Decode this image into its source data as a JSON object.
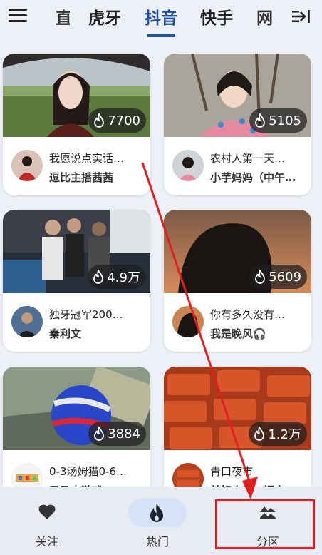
{
  "header": {
    "tabs": [
      {
        "label": "直",
        "state": "partial"
      },
      {
        "label": "虎牙",
        "state": "normal"
      },
      {
        "label": "抖音",
        "state": "active"
      },
      {
        "label": "快手",
        "state": "normal"
      },
      {
        "label": "网",
        "state": "partial"
      }
    ],
    "left_icon": "menu-icon",
    "right_icon": "collapse-sidebar-icon"
  },
  "cards": [
    {
      "title": "我愿说点实话…",
      "author": "逗比主播茜茜",
      "heat": "7700"
    },
    {
      "title": "农村人第一天…",
      "author": "小芋妈妈（中午…",
      "heat": "5105"
    },
    {
      "title": "独牙冠军200…",
      "author": "秦利文",
      "heat": "4.9万"
    },
    {
      "title": "你有多久没有…",
      "author": "我是晚风🎧",
      "heat": "5609"
    },
    {
      "title": "0-3汤姆猫0-6…",
      "author": "马马去游戏",
      "heat": "3884"
    },
    {
      "title": "青口夜市",
      "author": "美好小吃…福宝",
      "heat": "1.2万"
    }
  ],
  "bottom_nav": [
    {
      "label": "关注",
      "icon": "heart-icon"
    },
    {
      "label": "热门",
      "icon": "flame-icon",
      "selected": true
    },
    {
      "label": "分区",
      "icon": "mountain-icon"
    }
  ],
  "colors": {
    "accent": "#1e4fa3",
    "background": "#eef0f7",
    "annotation": "#e02020"
  }
}
